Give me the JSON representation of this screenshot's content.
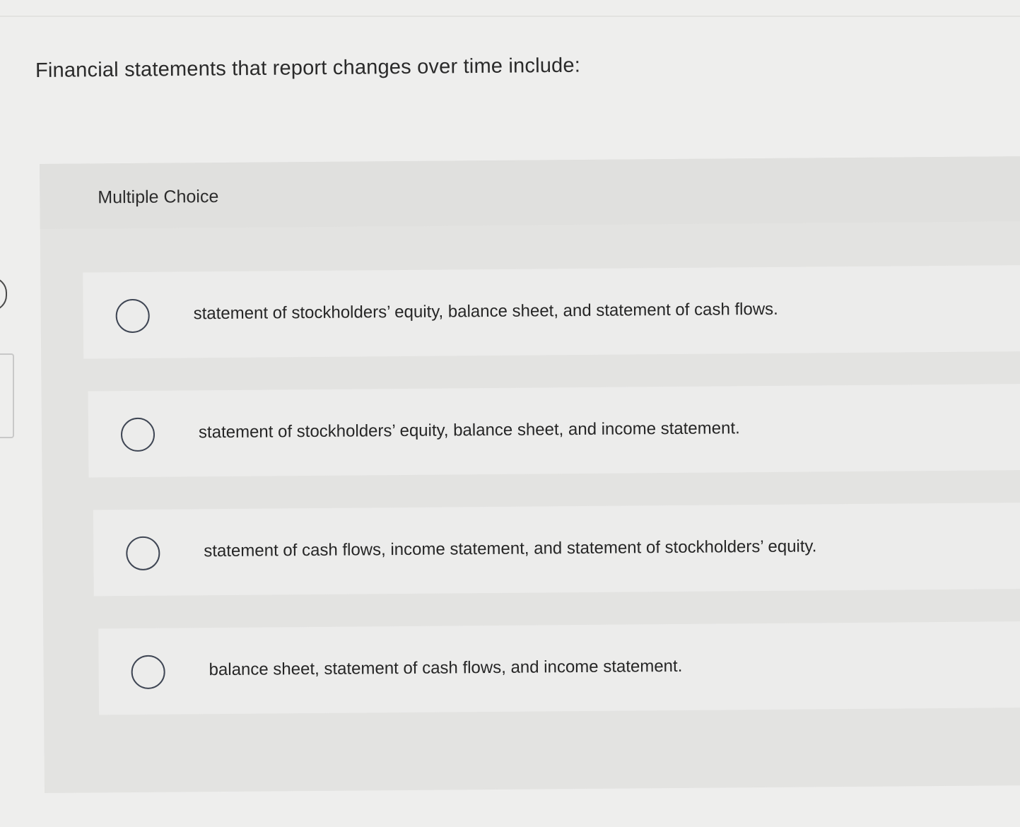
{
  "question": {
    "prompt": "Financial statements that report changes over time include:"
  },
  "multiple_choice": {
    "label": "Multiple Choice",
    "options": [
      {
        "text": "statement of stockholders’ equity, balance sheet, and statement of cash flows.",
        "selected": false
      },
      {
        "text": "statement of stockholders’ equity, balance sheet, and income statement.",
        "selected": false
      },
      {
        "text": "statement of cash flows, income statement, and statement of stockholders’ equity.",
        "selected": false
      },
      {
        "text": "balance sheet, statement of cash flows, and income statement.",
        "selected": false
      }
    ]
  }
}
